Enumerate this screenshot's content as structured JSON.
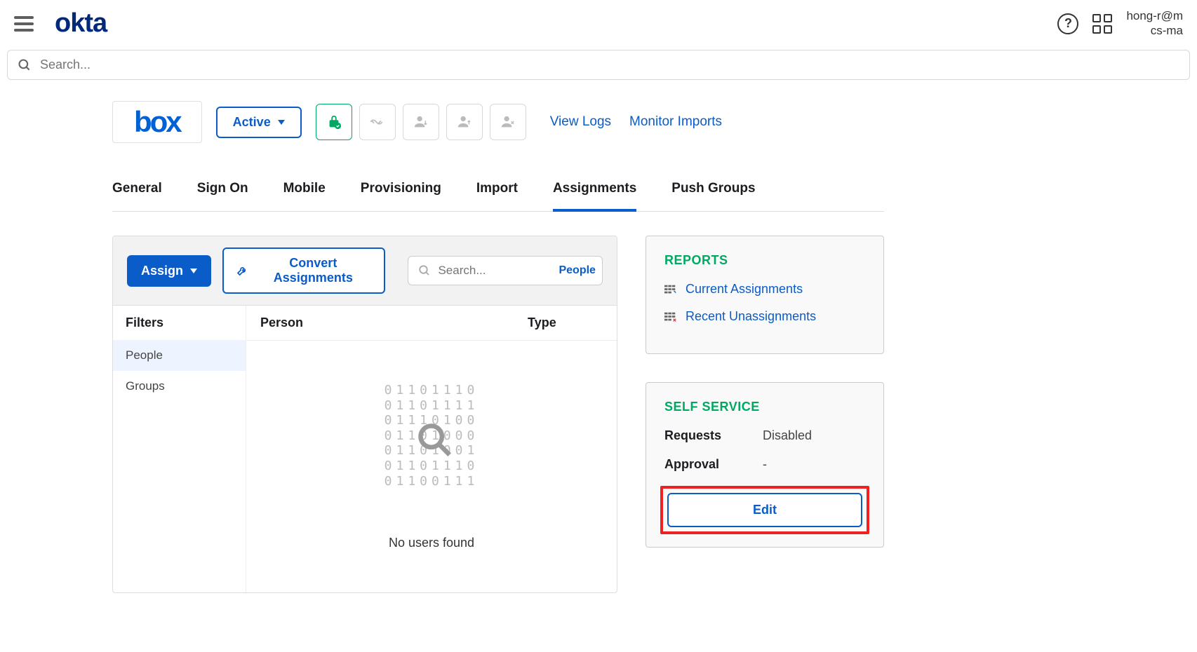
{
  "topbar": {
    "logo": "okta",
    "user_line1": "hong-r@m",
    "user_line2": "cs-ma"
  },
  "search": {
    "placeholder": "Search..."
  },
  "app": {
    "name": "box",
    "status": "Active",
    "links": {
      "view_logs": "View Logs",
      "monitor_imports": "Monitor Imports"
    }
  },
  "tabs": [
    {
      "label": "General"
    },
    {
      "label": "Sign On"
    },
    {
      "label": "Mobile"
    },
    {
      "label": "Provisioning"
    },
    {
      "label": "Import"
    },
    {
      "label": "Assignments",
      "active": true
    },
    {
      "label": "Push Groups"
    }
  ],
  "toolbar": {
    "assign": "Assign",
    "convert": "Convert Assignments",
    "search_placeholder": "Search...",
    "scope": "People"
  },
  "filters": {
    "heading": "Filters",
    "items": [
      {
        "label": "People",
        "active": true
      },
      {
        "label": "Groups"
      }
    ]
  },
  "table": {
    "cols": {
      "person": "Person",
      "type": "Type"
    },
    "empty": "No users found",
    "binary": "01101110\n01101111\n01110100\n01101000\n01101001\n01101110\n01100111"
  },
  "reports": {
    "title": "REPORTS",
    "current": "Current Assignments",
    "recent": "Recent Unassignments"
  },
  "self_service": {
    "title": "SELF SERVICE",
    "requests_label": "Requests",
    "requests_value": "Disabled",
    "approval_label": "Approval",
    "approval_value": "-",
    "edit": "Edit"
  }
}
